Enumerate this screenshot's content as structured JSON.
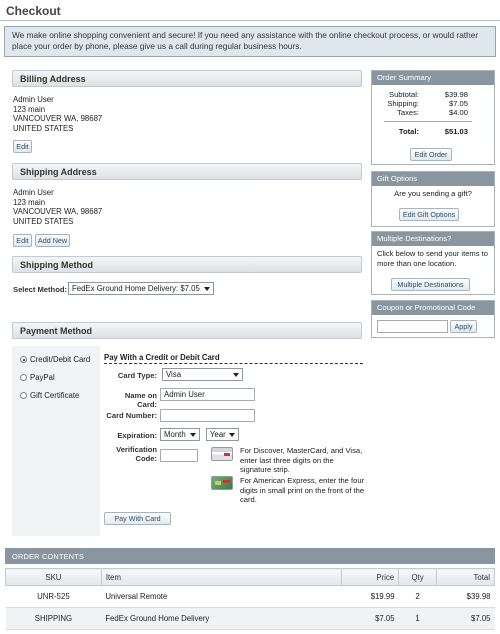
{
  "page": {
    "title": "Checkout"
  },
  "intro": "We make online shopping convenient and secure! If you need any assistance with the online checkout process, or would rather place your order by phone, please give us a call during regular business hours.",
  "billing": {
    "title": "Billing Address",
    "lines": [
      "Admin User",
      "123 main",
      "VANCOUVER WA, 98687",
      "UNITED STATES"
    ],
    "edit_label": "Edit"
  },
  "shipping": {
    "title": "Shipping Address",
    "lines": [
      "Admin User",
      "123 main",
      "VANCOUVER WA, 98687",
      "UNITED STATES"
    ],
    "edit_label": "Edit",
    "add_label": "Add New"
  },
  "shipping_method": {
    "title": "Shipping Method",
    "select_label": "Select Method:",
    "selected": "FedEx Ground Home Delivery: $7.05"
  },
  "payment": {
    "title": "Payment Method",
    "options": [
      "Credit/Debit Card",
      "PayPal",
      "Gift Certificate"
    ],
    "form_title": "Pay With a Credit or Debit Card",
    "card_type_label": "Card Type:",
    "card_type_value": "Visa",
    "name_label": "Name on Card:",
    "name_value": "Admin User",
    "number_label": "Card Number:",
    "number_value": "",
    "expiration_label": "Expiration:",
    "month_value": "Month",
    "year_value": "Year",
    "verification_label_1": "Verification",
    "verification_label_2": "Code:",
    "verification_value": "",
    "hint_discover": "For Discover, MasterCard, and Visa, enter last three digits on the signature strip.",
    "hint_amex": "For American Express, enter the four digits in small print on the front of the card.",
    "pay_label": "Pay With Card"
  },
  "order_summary": {
    "title": "Order Summary",
    "subtotal_label": "Subtotal:",
    "subtotal": "$39.98",
    "shipping_label": "Shipping:",
    "shipping": "$7.05",
    "taxes_label": "Taxes:",
    "taxes": "$4.00",
    "total_label": "Total:",
    "total": "$51.03",
    "edit_label": "Edit Order"
  },
  "gift": {
    "title": "Gift Options",
    "text": "Are you sending a gift?",
    "button": "Edit Gift Options"
  },
  "multi": {
    "title": "Multiple Destinations?",
    "text": "Click below to send your items to more than one location.",
    "button": "Multiple Destinations"
  },
  "coupon": {
    "title": "Coupon or Promotional Code",
    "value": "",
    "button": "Apply"
  },
  "order_contents": {
    "title": "ORDER CONTENTS",
    "columns": [
      "SKU",
      "Item",
      "Price",
      "Qty",
      "Total"
    ],
    "rows": [
      {
        "sku": "UNR-525",
        "item": "Universal Remote",
        "price": "$19.99",
        "qty": "2",
        "total": "$39.98"
      },
      {
        "sku": "SHIPPING",
        "item": "FedEx Ground Home Delivery",
        "price": "$7.05",
        "qty": "1",
        "total": "$7.05"
      }
    ]
  },
  "colors": {
    "panel_head": "#8a969f",
    "intro_bg": "#dfe7ee",
    "button_text": "#2d4a66"
  }
}
